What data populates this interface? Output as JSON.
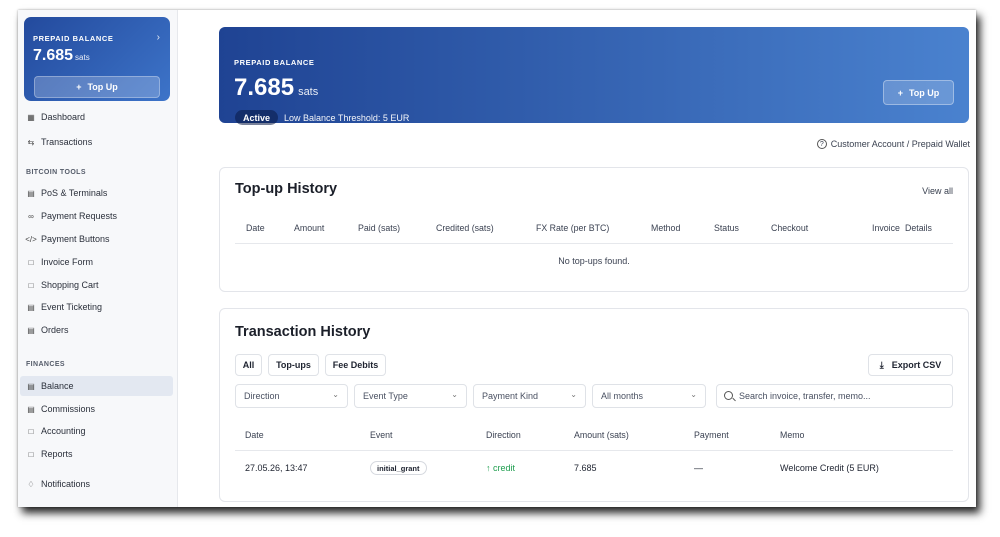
{
  "sidebar": {
    "balance_card": {
      "label": "PREPAID BALANCE",
      "amount": "7.685",
      "unit": "sats",
      "topup_label": "Top Up"
    },
    "nav": {
      "dashboard": "Dashboard",
      "transactions": "Transactions",
      "section_bitcoin": "BITCOIN TOOLS",
      "pos": "PoS & Terminals",
      "payment_requests": "Payment Requests",
      "payment_buttons": "Payment Buttons",
      "invoice_form": "Invoice Form",
      "shopping_cart": "Shopping Cart",
      "event_ticketing": "Event Ticketing",
      "orders": "Orders",
      "section_finances": "FINANCES",
      "balance": "Balance",
      "commissions": "Commissions",
      "accounting": "Accounting",
      "reports": "Reports",
      "notifications": "Notifications"
    },
    "active_item": "Balance"
  },
  "hero": {
    "label": "PREPAID BALANCE",
    "amount": "7.685",
    "unit": "sats",
    "status": "Active",
    "threshold": "Low Balance Threshold: 5 EUR",
    "topup_label": "Top Up"
  },
  "breadcrumb": "Customer Account / Prepaid Wallet",
  "topup_history": {
    "title": "Top-up History",
    "view_all": "View all",
    "columns": [
      "Date",
      "Amount",
      "Paid (sats)",
      "Credited (sats)",
      "FX Rate (per BTC)",
      "Method",
      "Status",
      "Checkout",
      "Invoice",
      "Details"
    ],
    "empty": "No top-ups found."
  },
  "transaction_history": {
    "title": "Transaction History",
    "tabs": [
      "All",
      "Top-ups",
      "Fee Debits"
    ],
    "export_label": "Export CSV",
    "filters": {
      "direction": "Direction",
      "event_type": "Event Type",
      "payment_kind": "Payment Kind",
      "months": "All months"
    },
    "search_placeholder": "Search invoice, transfer, memo...",
    "columns": [
      "Date",
      "Event",
      "Direction",
      "Amount (sats)",
      "Payment",
      "Memo"
    ],
    "rows": [
      {
        "date": "27.05.26, 13:47",
        "event": "initial_grant",
        "direction": "credit",
        "amount": "7.685",
        "payment": "—",
        "memo": "Welcome Credit (5 EUR)"
      }
    ]
  },
  "colors": {
    "brand": "#234a9d",
    "credit": "#1f9e4f",
    "active_nav_bg": "#e3e8f1"
  }
}
